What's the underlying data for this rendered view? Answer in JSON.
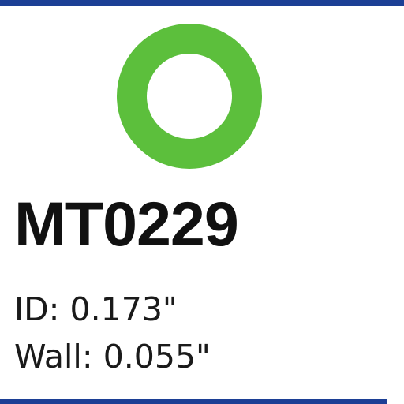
{
  "product": {
    "part_number": "MT0229",
    "specs": [
      {
        "label": "ID:",
        "value": "0.173\""
      },
      {
        "label": "Wall:",
        "value": "0.055\""
      }
    ]
  },
  "icons": {
    "ring": "o-ring-icon"
  },
  "colors": {
    "accent_rule": "#1c3f95",
    "ring_green": "#5cbf3c",
    "text": "#111111",
    "background": "#ffffff"
  }
}
